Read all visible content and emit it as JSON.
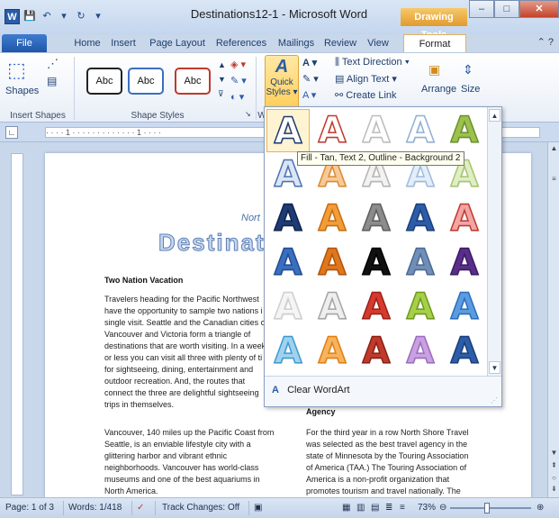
{
  "window": {
    "title": "Destinations12-1 - Microsoft Word",
    "contextual_tab_group": "Drawing Tools",
    "word_icon_letter": "W"
  },
  "tabs": [
    "File",
    "Home",
    "Insert",
    "Page Layout",
    "References",
    "Mailings",
    "Review",
    "View",
    "Format"
  ],
  "active_tab": "Format",
  "ribbon": {
    "insert_shapes": {
      "label": "Insert Shapes",
      "shapes_button": "Shapes"
    },
    "shape_styles": {
      "label": "Shape Styles",
      "samples": [
        "Abc",
        "Abc",
        "Abc"
      ]
    },
    "wordart": {
      "quick_styles_label": "Quick",
      "quick_styles_label2": "Styles",
      "group_label_visible": "W"
    },
    "text": {
      "text_direction": "Text Direction",
      "align_text": "Align Text",
      "create_link": "Create Link"
    },
    "arrange": {
      "label": "Arrange"
    },
    "size": {
      "label": "Size"
    }
  },
  "document": {
    "header_fragment": "Nort",
    "title_fragment": "Destinati",
    "col1_heading": "Two Nation Vacation",
    "col1_para1": [
      "Travelers heading for the Pacific Northwest",
      "have the opportunity to sample two nations i",
      "single visit. Seattle and the Canadian cities of",
      "Vancouver and Victoria form a triangle of",
      "destinations that are worth visiting. In a week",
      "or less you can visit all three with plenty of ti",
      "for sightseeing, dining, entertainment and",
      "outdoor recreation. And, the routes that",
      "connect the three are delightful sightseeing",
      "trips in themselves."
    ],
    "col1_para2": [
      "Vancouver, 140 miles up the Pacific Coast from",
      "Seattle, is an enviable lifestyle city with a",
      "glittering harbor and vibrant ethnic",
      "neighborhoods. Vancouver has world-class",
      "museums and one of the best aquariums in",
      "North America."
    ],
    "col2_heading": "Agency",
    "col2_para": [
      "For the third year in a row North Shore Travel",
      "was selected as the best travel agency in the",
      "state of Minnesota by the Touring Association",
      "of America (TAA.) The Touring Association of",
      "America is a non-profit organization that",
      "promotes tourism and travel nationally. The"
    ]
  },
  "gallery": {
    "glyph": "A",
    "tooltip": "Fill - Tan, Text 2, Outline - Background 2",
    "clear_label": "Clear WordArt",
    "styles": [
      {
        "fill": "#ffffff",
        "stroke": "#1f3b73"
      },
      {
        "fill": "#ffffff",
        "stroke": "#c0392b"
      },
      {
        "fill": "#ffffff",
        "stroke": "#bdbdbd"
      },
      {
        "fill": "#ffffff",
        "stroke": "#8fb0d8"
      },
      {
        "fill": "#9bc24c",
        "stroke": "#6d8f2d"
      },
      {
        "fill": "#dbe6f5",
        "stroke": "#4c73b3"
      },
      {
        "fill": "#f6c99a",
        "stroke": "#e08a2a"
      },
      {
        "fill": "#f2f2f2",
        "stroke": "#b5b5b5"
      },
      {
        "fill": "#e3eef9",
        "stroke": "#9dbbe0"
      },
      {
        "fill": "#dfeec3",
        "stroke": "#a8c570"
      },
      {
        "fill": "#1f3b73",
        "stroke": "#0e2250"
      },
      {
        "fill": "#f39c3a",
        "stroke": "#c76d10"
      },
      {
        "fill": "#8c8c8c",
        "stroke": "#5e5e5e"
      },
      {
        "fill": "#2d5ca8",
        "stroke": "#1a3f7a"
      },
      {
        "fill": "#f3a5a5",
        "stroke": "#c0392b"
      },
      {
        "fill": "#3a6fc0",
        "stroke": "#1f4c91"
      },
      {
        "fill": "#e0761d",
        "stroke": "#b2540a"
      },
      {
        "fill": "#111111",
        "stroke": "#000000"
      },
      {
        "fill": "#6f8fb9",
        "stroke": "#4a6894"
      },
      {
        "fill": "#5b2d8a",
        "stroke": "#3a1a63"
      },
      {
        "fill": "#f5f5f5",
        "stroke": "#cfcfcf"
      },
      {
        "fill": "#eeeeee",
        "stroke": "#a5a5a5"
      },
      {
        "fill": "#d63a2e",
        "stroke": "#9a1f16"
      },
      {
        "fill": "#a6d04a",
        "stroke": "#6d9a1a"
      },
      {
        "fill": "#5b9be0",
        "stroke": "#2b6dbd"
      },
      {
        "fill": "#9ed2ef",
        "stroke": "#3d9ad1"
      },
      {
        "fill": "#f7b35d",
        "stroke": "#e07f12"
      },
      {
        "fill": "#c0392b",
        "stroke": "#8a1f14"
      },
      {
        "fill": "#c9a0e0",
        "stroke": "#9b6bc0"
      },
      {
        "fill": "#2d5ca8",
        "stroke": "#1a3f7a"
      }
    ]
  },
  "statusbar": {
    "page": "Page: 1 of 3",
    "words": "Words: 1/418",
    "track_changes": "Track Changes: Off",
    "zoom": "73%"
  }
}
